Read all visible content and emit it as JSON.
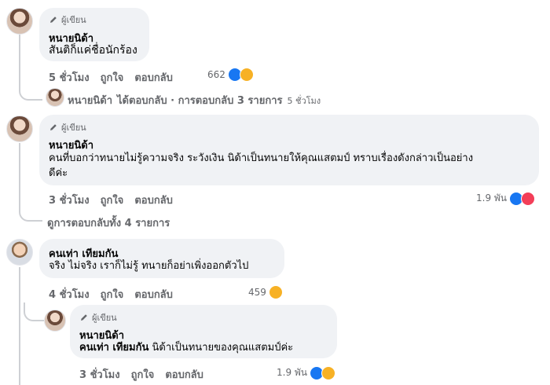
{
  "badge_label": "ผู้เขียน",
  "comments": [
    {
      "author": "หนายนิด้า",
      "text": "สันติก็แค่ชื่อนักร้อง",
      "time": "5 ชั่วโมง",
      "like": "ถูกใจ",
      "reply": "ตอบกลับ",
      "reaction_count": "662"
    },
    {
      "author": "หนายนิด้า",
      "text_line1": "คนที่บอกว่าทนายไม่รู้ความจริง ระวังเงิน นิด้าเป็นทนายให้คุณแสตมป์ ทราบเรื่องดังกล่าวเป็นอย่าง",
      "text_line2": "ดีค่ะ",
      "time": "3 ชั่วโมง",
      "like": "ถูกใจ",
      "reply": "ตอบกลับ",
      "reaction_count": "1.9 พัน"
    },
    {
      "author": "คนเท่า เทียมกัน",
      "text": "จริง ไม่จริง เราก็ไม่รู้ ทนายก็อย่าเพิ่งออกตัวไป",
      "time": "4 ชั่วโมง",
      "like": "ถูกใจ",
      "reply": "ตอบกลับ",
      "reaction_count": "459"
    },
    {
      "author": "หนายนิด้า",
      "mention": "คนเท่า เทียมกัน",
      "text": " นิด้าเป็นทนายของคุณแสตมป์ค่ะ",
      "time": "3 ชั่วโมง",
      "like": "ถูกใจ",
      "reply": "ตอบกลับ",
      "reaction_count": "1.9 พัน"
    }
  ],
  "replies_summary": {
    "author": "หนายนิด้า",
    "text": "ได้ตอบกลับ · การตอบกลับ 3 รายการ",
    "time": "5 ชั่วโมง"
  },
  "view_all_replies": "ดูการตอบกลับทั้ง 4 รายการ",
  "colors": {
    "like": "#1877f2",
    "haha": "#f7b125",
    "love": "#f33e58",
    "bubble": "#f0f2f5",
    "meta": "#65676b"
  }
}
